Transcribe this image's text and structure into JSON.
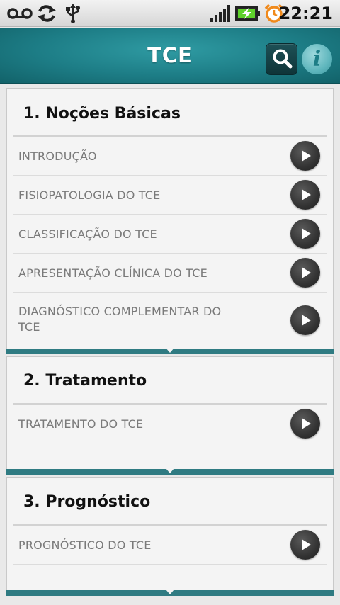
{
  "status_bar": {
    "time": "22:21",
    "icons": [
      "voicemail-icon",
      "sync-icon",
      "usb-icon",
      "signal-icon",
      "battery-charging-icon",
      "alarm-icon"
    ]
  },
  "app_bar": {
    "title": "TCE",
    "actions": [
      "search-icon",
      "info-icon"
    ],
    "info_glyph": "i"
  },
  "sections": [
    {
      "title": "1. Noções Básicas",
      "items": [
        "INTRODUÇÃO",
        "FISIOPATOLOGIA DO TCE",
        "CLASSIFICAÇÃO DO TCE",
        "APRESENTAÇÃO CLÍNICA DO TCE",
        "DIAGNÓSTICO COMPLEMENTAR DO TCE"
      ]
    },
    {
      "title": "2. Tratamento",
      "items": [
        "TRATAMENTO DO TCE"
      ]
    },
    {
      "title": "3. Prognóstico",
      "items": [
        "PROGNÓSTICO DO TCE"
      ]
    }
  ],
  "colors": {
    "app_bar": "#1d7d86",
    "section_footer": "#2f7b82",
    "play_button": "#333333",
    "item_text": "#7a7a7a"
  }
}
